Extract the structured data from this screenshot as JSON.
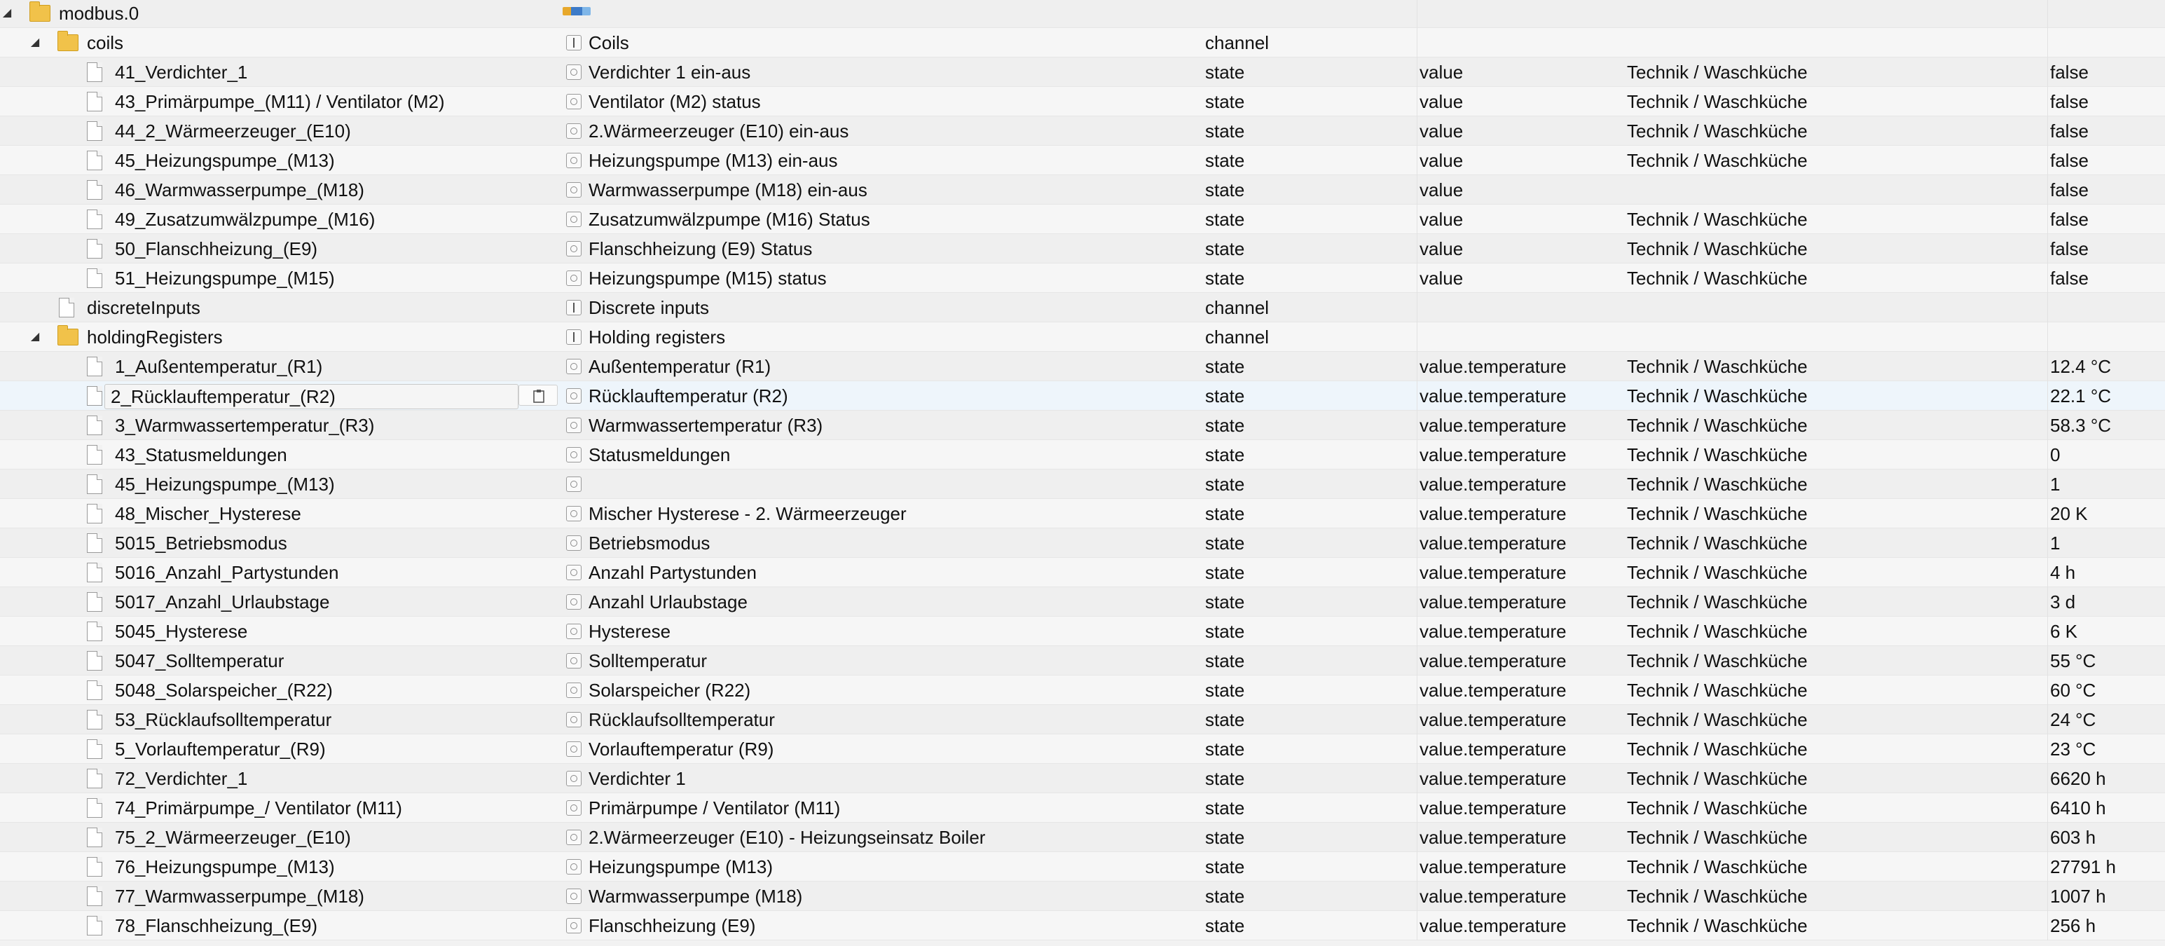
{
  "colors": {
    "folder": "#f1c24a",
    "selected_row": "#eef5fb",
    "background": "#f2f2f2"
  },
  "tree": {
    "rows": [
      {
        "kind": "folder",
        "level": 0,
        "expanded": true,
        "name": "modbus.0",
        "title_icon": "adapter-logo-icon",
        "title": "",
        "type": "",
        "role": "",
        "room": "",
        "value": ""
      },
      {
        "kind": "folder",
        "level": 1,
        "expanded": true,
        "name": "coils",
        "title_icon": "channel-icon",
        "title": "Coils",
        "type": "channel",
        "role": "",
        "room": "",
        "value": ""
      },
      {
        "kind": "state",
        "level": 2,
        "name": "41_Verdichter_1",
        "title_icon": "state-icon",
        "title": "Verdichter 1 ein-aus",
        "type": "state",
        "role": "value",
        "room": "Technik / Waschküche",
        "value": "false"
      },
      {
        "kind": "state",
        "level": 2,
        "name": "43_Primärpumpe_(M11) / Ventilator (M2)",
        "title_icon": "state-icon",
        "title": "Ventilator (M2) status",
        "type": "state",
        "role": "value",
        "room": "Technik / Waschküche",
        "value": "false"
      },
      {
        "kind": "state",
        "level": 2,
        "name": "44_2_Wärmeerzeuger_(E10)",
        "title_icon": "state-icon",
        "title": "2.Wärmeerzeuger (E10) ein-aus",
        "type": "state",
        "role": "value",
        "room": "Technik / Waschküche",
        "value": "false"
      },
      {
        "kind": "state",
        "level": 2,
        "name": "45_Heizungspumpe_(M13)",
        "title_icon": "state-icon",
        "title": "Heizungspumpe (M13) ein-aus",
        "type": "state",
        "role": "value",
        "room": "Technik / Waschküche",
        "value": "false"
      },
      {
        "kind": "state",
        "level": 2,
        "name": "46_Warmwasserpumpe_(M18)",
        "title_icon": "state-icon",
        "title": "Warmwasserpumpe (M18) ein-aus",
        "type": "state",
        "role": "value",
        "room": "",
        "value": "false"
      },
      {
        "kind": "state",
        "level": 2,
        "name": "49_Zusatzumwälzpumpe_(M16)",
        "title_icon": "state-icon",
        "title": "Zusatzumwälzpumpe (M16) Status",
        "type": "state",
        "role": "value",
        "room": "Technik / Waschküche",
        "value": "false"
      },
      {
        "kind": "state",
        "level": 2,
        "name": "50_Flanschheizung_(E9)",
        "title_icon": "state-icon",
        "title": "Flanschheizung (E9) Status",
        "type": "state",
        "role": "value",
        "room": "Technik / Waschküche",
        "value": "false"
      },
      {
        "kind": "state",
        "level": 2,
        "name": "51_Heizungspumpe_(M15)",
        "title_icon": "state-icon",
        "title": "Heizungspumpe (M15) status",
        "type": "state",
        "role": "value",
        "room": "Technik / Waschküche",
        "value": "false"
      },
      {
        "kind": "file",
        "level": 1,
        "name": "discreteInputs",
        "title_icon": "channel-icon",
        "title": "Discrete inputs",
        "type": "channel",
        "role": "",
        "room": "",
        "value": ""
      },
      {
        "kind": "folder",
        "level": 1,
        "expanded": true,
        "name": "holdingRegisters",
        "title_icon": "channel-icon",
        "title": "Holding registers",
        "type": "channel",
        "role": "",
        "room": "",
        "value": ""
      },
      {
        "kind": "state",
        "level": 2,
        "name": "1_Außentemperatur_(R1)",
        "title_icon": "state-icon",
        "title": "Außentemperatur (R1)",
        "type": "state",
        "role": "value.temperature",
        "room": "Technik / Waschküche",
        "value": "12.4 °C"
      },
      {
        "kind": "state",
        "level": 2,
        "selected": true,
        "name": "2_Rücklauftemperatur_(R2)",
        "title_icon": "state-icon",
        "title": "Rücklauftemperatur (R2)",
        "type": "state",
        "role": "value.temperature",
        "room": "Technik / Waschküche",
        "value": "22.1 °C"
      },
      {
        "kind": "state",
        "level": 2,
        "name": "3_Warmwassertemperatur_(R3)",
        "title_icon": "state-icon",
        "title": "Warmwassertemperatur (R3)",
        "type": "state",
        "role": "value.temperature",
        "room": "Technik / Waschküche",
        "value": "58.3 °C"
      },
      {
        "kind": "state",
        "level": 2,
        "name": "43_Statusmeldungen",
        "title_icon": "state-icon",
        "title": "Statusmeldungen",
        "type": "state",
        "role": "value.temperature",
        "room": "Technik / Waschküche",
        "value": "0"
      },
      {
        "kind": "state",
        "level": 2,
        "name": "45_Heizungspumpe_(M13)",
        "title_icon": "state-icon",
        "title": "",
        "type": "state",
        "role": "value.temperature",
        "room": "Technik / Waschküche",
        "value": "1"
      },
      {
        "kind": "state",
        "level": 2,
        "name": "48_Mischer_Hysterese",
        "title_icon": "state-icon",
        "title": "Mischer Hysterese - 2. Wärmeerzeuger",
        "type": "state",
        "role": "value.temperature",
        "room": "Technik / Waschküche",
        "value": "20 K"
      },
      {
        "kind": "state",
        "level": 2,
        "name": "5015_Betriebsmodus",
        "title_icon": "state-icon",
        "title": "Betriebsmodus",
        "type": "state",
        "role": "value.temperature",
        "room": "Technik / Waschküche",
        "value": "1"
      },
      {
        "kind": "state",
        "level": 2,
        "name": "5016_Anzahl_Partystunden",
        "title_icon": "state-icon",
        "title": "Anzahl Partystunden",
        "type": "state",
        "role": "value.temperature",
        "room": "Technik / Waschküche",
        "value": "4 h"
      },
      {
        "kind": "state",
        "level": 2,
        "name": "5017_Anzahl_Urlaubstage",
        "title_icon": "state-icon",
        "title": "Anzahl Urlaubstage",
        "type": "state",
        "role": "value.temperature",
        "room": "Technik / Waschküche",
        "value": "3 d"
      },
      {
        "kind": "state",
        "level": 2,
        "name": "5045_Hysterese",
        "title_icon": "state-icon",
        "title": "Hysterese",
        "type": "state",
        "role": "value.temperature",
        "room": "Technik / Waschküche",
        "value": "6 K"
      },
      {
        "kind": "state",
        "level": 2,
        "name": "5047_Solltemperatur",
        "title_icon": "state-icon",
        "title": "Solltemperatur",
        "type": "state",
        "role": "value.temperature",
        "room": "Technik / Waschküche",
        "value": "55 °C"
      },
      {
        "kind": "state",
        "level": 2,
        "name": "5048_Solarspeicher_(R22)",
        "title_icon": "state-icon",
        "title": "Solarspeicher (R22)",
        "type": "state",
        "role": "value.temperature",
        "room": "Technik / Waschküche",
        "value": "60 °C"
      },
      {
        "kind": "state",
        "level": 2,
        "name": "53_Rücklaufsolltemperatur",
        "title_icon": "state-icon",
        "title": "Rücklaufsolltemperatur",
        "type": "state",
        "role": "value.temperature",
        "room": "Technik / Waschküche",
        "value": "24 °C"
      },
      {
        "kind": "state",
        "level": 2,
        "name": "5_Vorlauftemperatur_(R9)",
        "title_icon": "state-icon",
        "title": "Vorlauftemperatur (R9)",
        "type": "state",
        "role": "value.temperature",
        "room": "Technik / Waschküche",
        "value": "23 °C"
      },
      {
        "kind": "state",
        "level": 2,
        "name": "72_Verdichter_1",
        "title_icon": "state-icon",
        "title": "Verdichter 1",
        "type": "state",
        "role": "value.temperature",
        "room": "Technik / Waschküche",
        "value": "6620 h"
      },
      {
        "kind": "state",
        "level": 2,
        "name": "74_Primärpumpe_/ Ventilator (M11)",
        "title_icon": "state-icon",
        "title": "Primärpumpe / Ventilator (M11)",
        "type": "state",
        "role": "value.temperature",
        "room": "Technik / Waschküche",
        "value": "6410 h"
      },
      {
        "kind": "state",
        "level": 2,
        "name": "75_2_Wärmeerzeuger_(E10)",
        "title_icon": "state-icon",
        "title": "2.Wärmeerzeuger (E10) - Heizungseinsatz Boiler",
        "type": "state",
        "role": "value.temperature",
        "room": "Technik / Waschküche",
        "value": "603 h"
      },
      {
        "kind": "state",
        "level": 2,
        "name": "76_Heizungspumpe_(M13)",
        "title_icon": "state-icon",
        "title": "Heizungspumpe (M13)",
        "type": "state",
        "role": "value.temperature",
        "room": "Technik / Waschküche",
        "value": "27791 h"
      },
      {
        "kind": "state",
        "level": 2,
        "name": "77_Warmwasserpumpe_(M18)",
        "title_icon": "state-icon",
        "title": "Warmwasserpumpe (M18)",
        "type": "state",
        "role": "value.temperature",
        "room": "Technik / Waschküche",
        "value": "1007 h"
      },
      {
        "kind": "state",
        "level": 2,
        "name": "78_Flanschheizung_(E9)",
        "title_icon": "state-icon",
        "title": "Flanschheizung (E9)",
        "type": "state",
        "role": "value.temperature",
        "room": "Technik / Waschküche",
        "value": "256 h"
      }
    ]
  }
}
